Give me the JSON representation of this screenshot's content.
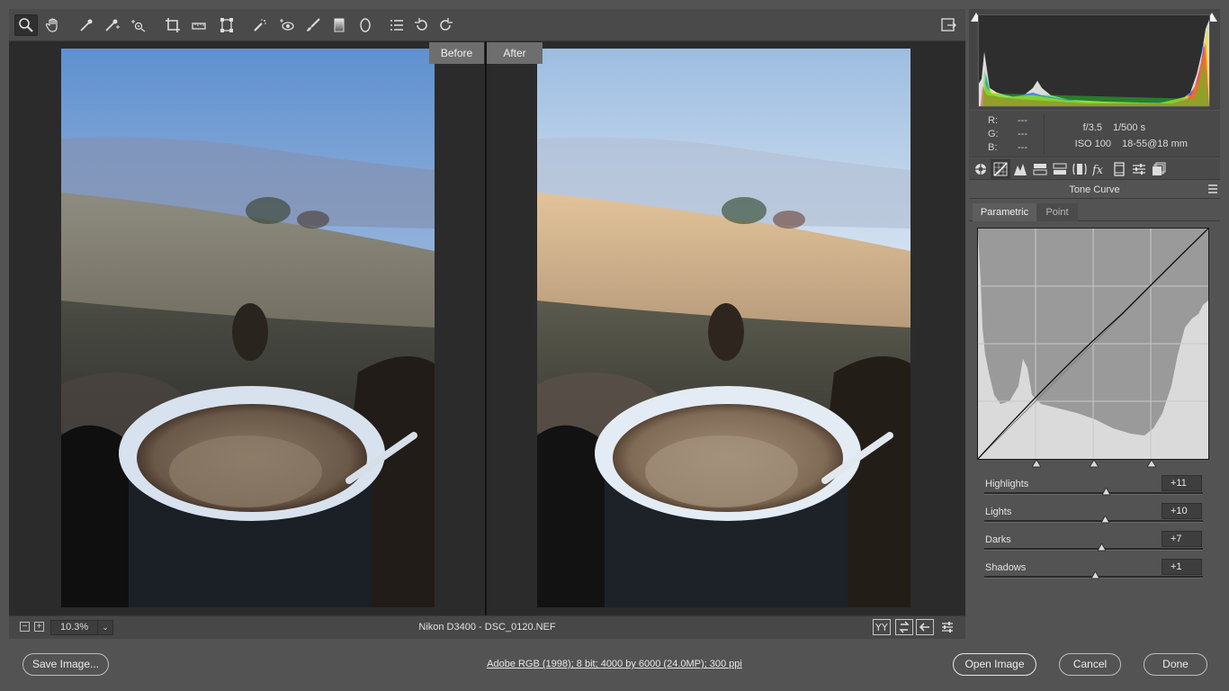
{
  "toolbar": {
    "tools": [
      "zoom-tool-icon",
      "hand-tool-icon",
      "white-balance-icon",
      "color-sampler-icon",
      "targeted-adjustment-icon",
      "crop-icon",
      "straighten-icon",
      "transform-icon",
      "spot-removal-icon",
      "red-eye-icon",
      "adjustment-brush-icon",
      "graduated-filter-icon",
      "radial-filter-icon",
      "presets-list-icon",
      "rotate-ccw-icon",
      "rotate-cw-icon"
    ]
  },
  "preview": {
    "before_label": "Before",
    "after_label": "After"
  },
  "status": {
    "zoom_value": "10.3%",
    "zoom_out": "−",
    "zoom_in": "+",
    "zoom_arrow": "⌄",
    "filename": "Nikon D3400  -  DSC_0120.NEF"
  },
  "info": {
    "r_label": "R:",
    "r_value": "---",
    "g_label": "G:",
    "g_value": "---",
    "b_label": "B:",
    "b_value": "---",
    "aperture": "f/3.5",
    "shutter": "1/500 s",
    "iso": "ISO 100",
    "lens": "18-55@18 mm"
  },
  "panel": {
    "title": "Tone Curve",
    "subtab_parametric": "Parametric",
    "subtab_point": "Point",
    "tab_icons": [
      "basic-icon",
      "tone-curve-icon",
      "detail-icon",
      "hsl-icon",
      "split-toning-icon",
      "lens-corrections-icon",
      "effects-icon",
      "camera-calibration-icon",
      "presets-icon",
      "snapshots-icon"
    ],
    "sliders": [
      {
        "label": "Highlights",
        "value": "+11",
        "level": 11
      },
      {
        "label": "Lights",
        "value": "+10",
        "level": 10
      },
      {
        "label": "Darks",
        "value": "+7",
        "level": 7
      },
      {
        "label": "Shadows",
        "value": "+1",
        "level": 1
      }
    ]
  },
  "footer": {
    "save_label": "Save Image...",
    "workflow": "Adobe RGB (1998); 8 bit; 4000 by 6000 (24.0MP); 300 ppi",
    "open_label": "Open Image",
    "cancel_label": "Cancel",
    "done_label": "Done"
  }
}
